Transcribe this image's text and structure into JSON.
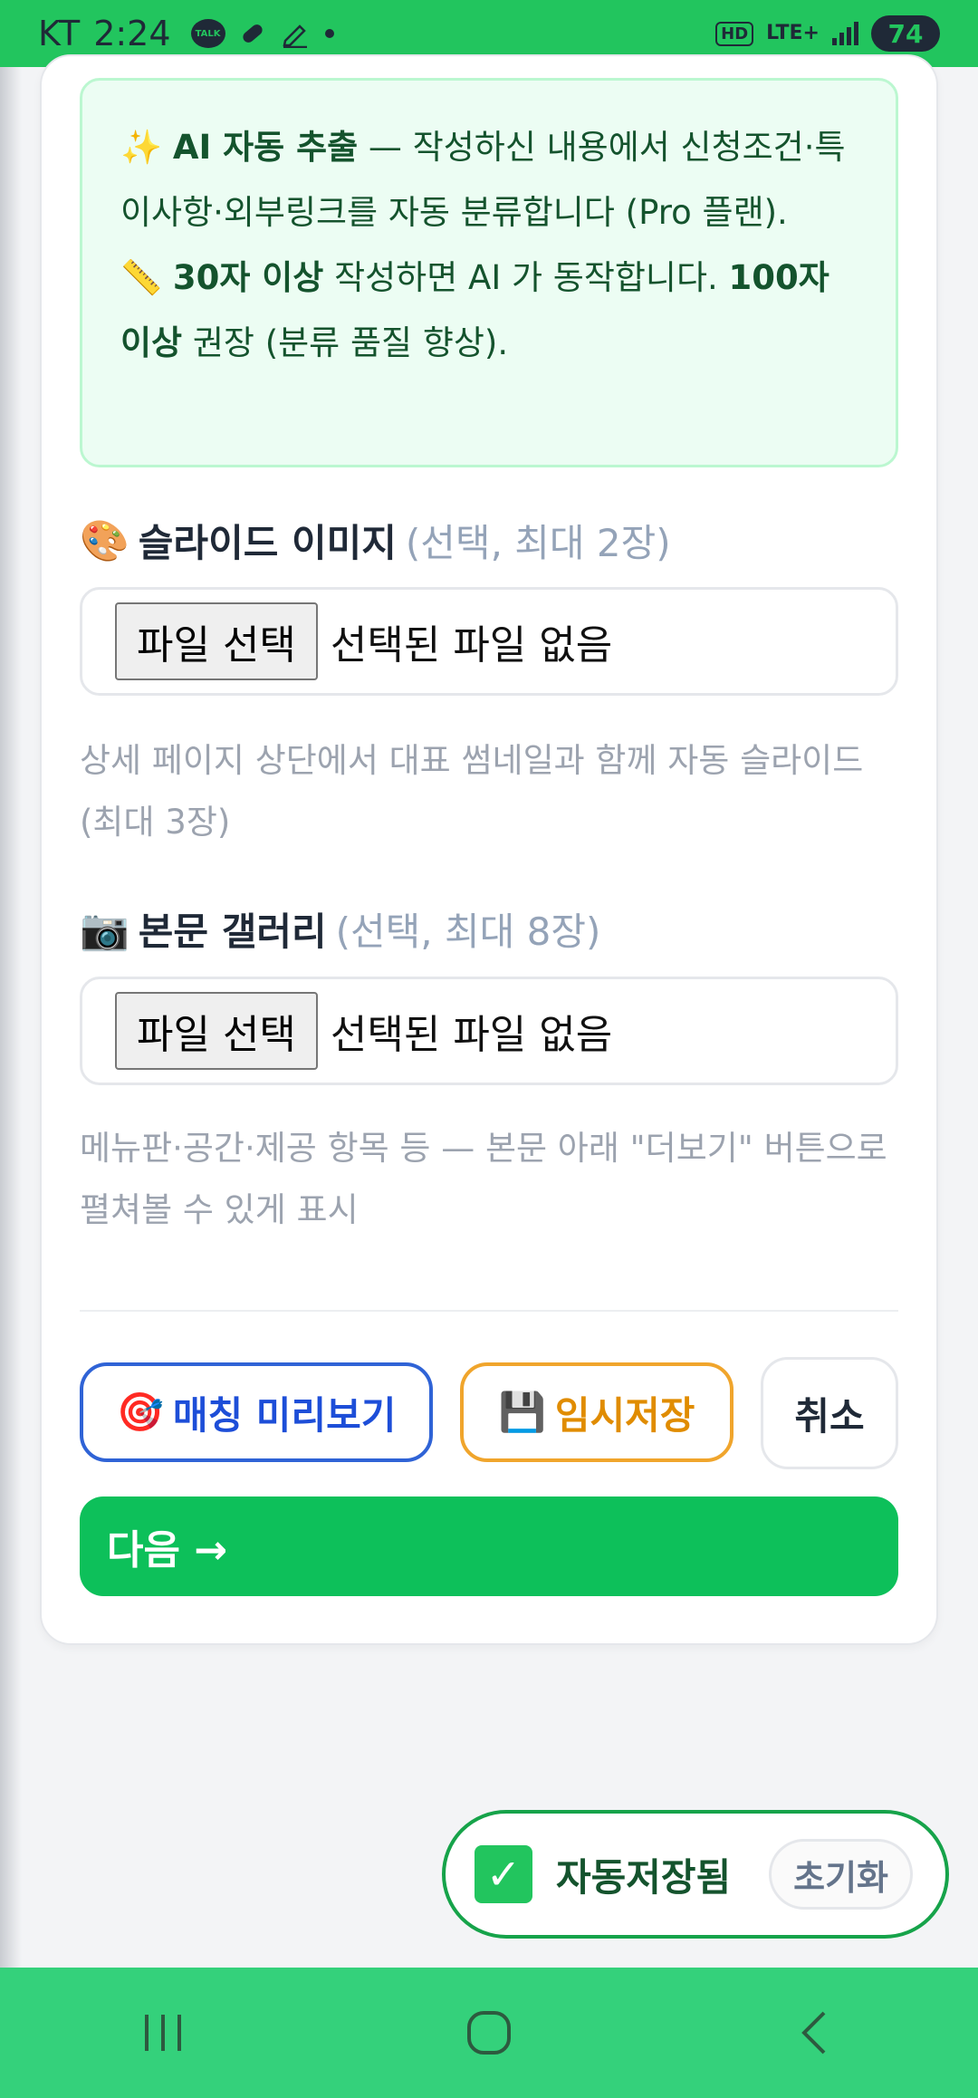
{
  "status_bar": {
    "carrier": "KT",
    "time": "2:24",
    "talk_badge": "TALK",
    "hd": "HD",
    "network": "LTE+",
    "battery": "74"
  },
  "info": {
    "emoji1": "✨",
    "title": "AI 자동 추출",
    "desc": " — 작성하신 내용에서 신청조건·특이사항·외부링크를 자동 분류합니다 (Pro 플랜).",
    "emoji2": "📏",
    "min_chars": "30자 이상",
    "min_desc": " 작성하면 AI 가 동작합니다. ",
    "rec_chars": "100자 이상",
    "rec_desc": " 권장 (분류 품질 향상)."
  },
  "slide_images": {
    "emoji": "🎨",
    "label": "슬라이드 이미지",
    "hint": "(선택, 최대 2장)",
    "file_button": "파일 선택",
    "file_status": "선택된 파일 없음",
    "help": "상세 페이지 상단에서 대표 썸네일과 함께 자동 슬라이드 (최대 3장)"
  },
  "gallery": {
    "emoji": "📷",
    "label": "본문 갤러리",
    "hint": "(선택, 최대 8장)",
    "file_button": "파일 선택",
    "file_status": "선택된 파일 없음",
    "help": "메뉴판·공간·제공 항목 등 — 본문 아래 \"더보기\" 버튼으로 펼쳐볼 수 있게 표시"
  },
  "actions": {
    "preview_emoji": "🎯",
    "preview": "매칭 미리보기",
    "draft_emoji": "💾",
    "draft": "임시저장",
    "cancel": "취소",
    "next": "다음 →"
  },
  "autosave": {
    "check": "✓",
    "label": "자동저장됨",
    "reset": "초기화"
  },
  "colors": {
    "accent_green": "#22c55e",
    "primary_blue": "#1d4ed8",
    "draft_orange": "#e08c00"
  }
}
